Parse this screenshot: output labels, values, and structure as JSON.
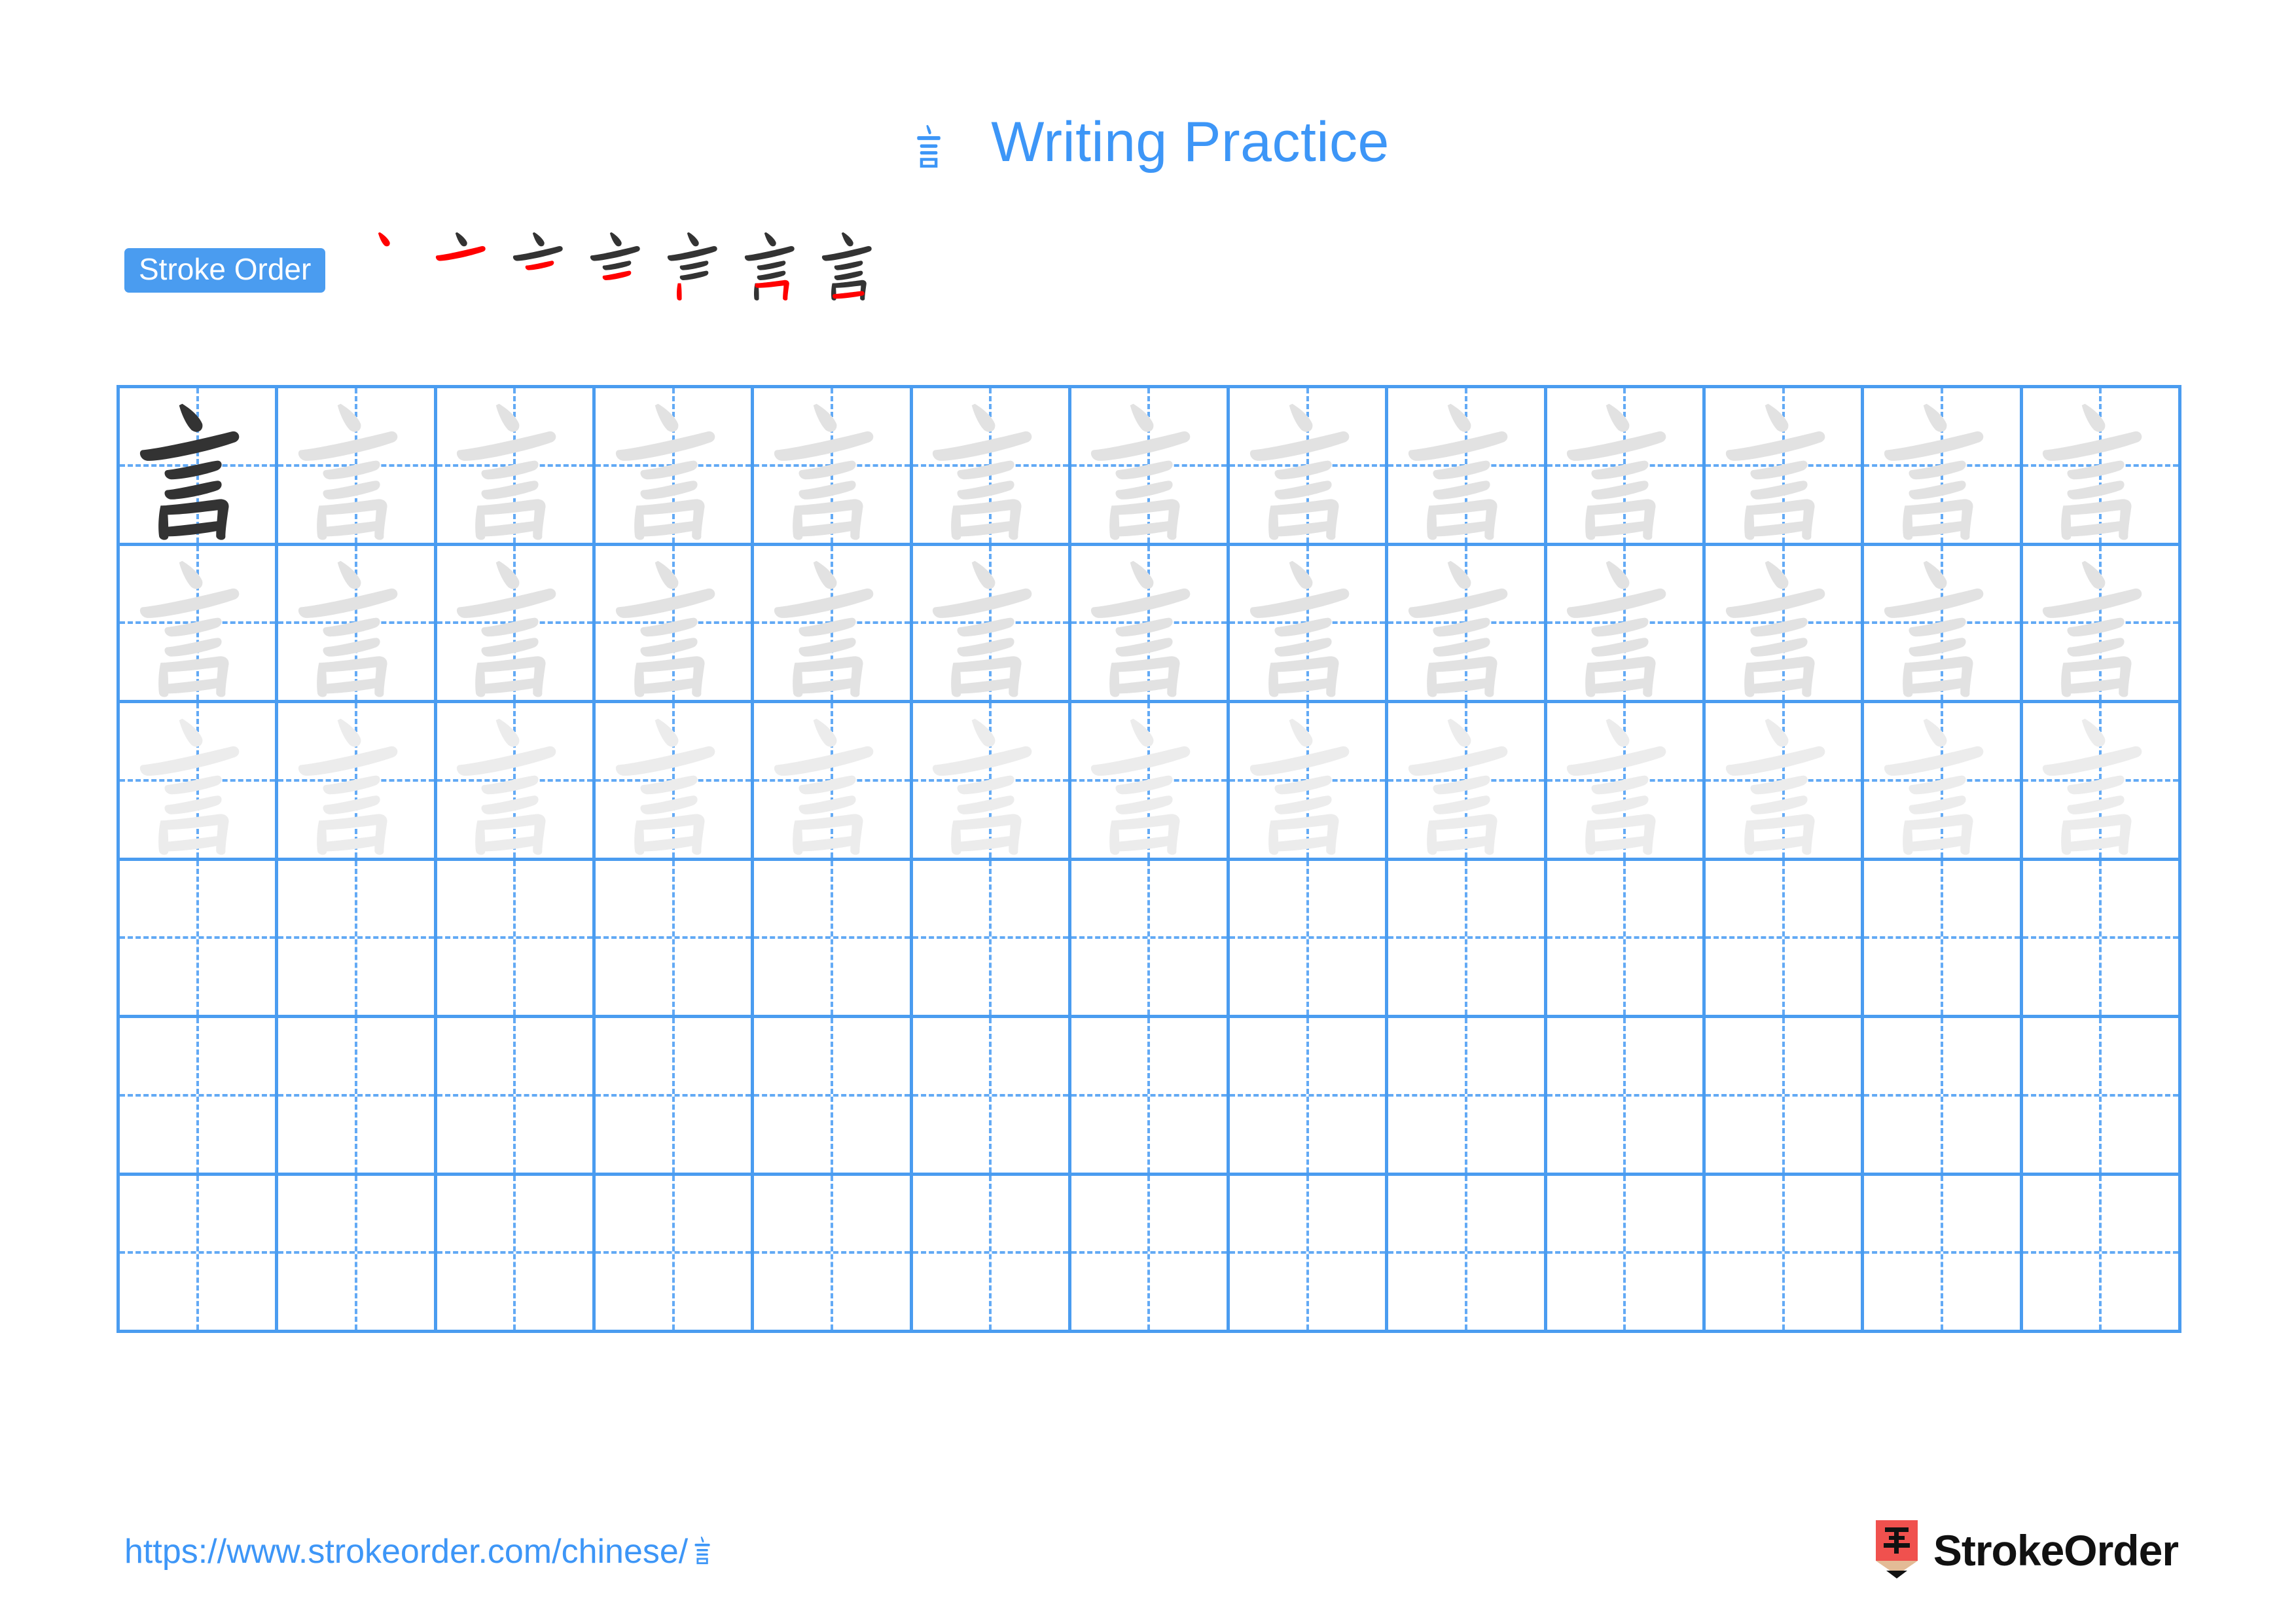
{
  "page": {
    "character": "言",
    "title_text": "Writing Practice",
    "background_color": "#ffffff",
    "accent_blue": "#3d96f7",
    "grid_blue": "#4a9cf0",
    "guide_blue": "#63aaf5",
    "ink_dark": "#333333",
    "ink_new": "#ff0000",
    "ink_trace": "#e2e2e2"
  },
  "stroke_order": {
    "badge_label": "Stroke Order",
    "stroke_count": 7,
    "steps": [
      {
        "index": 1,
        "completed_strokes": 0,
        "new_stroke": 1
      },
      {
        "index": 2,
        "completed_strokes": 1,
        "new_stroke": 2
      },
      {
        "index": 3,
        "completed_strokes": 2,
        "new_stroke": 3
      },
      {
        "index": 4,
        "completed_strokes": 3,
        "new_stroke": 4
      },
      {
        "index": 5,
        "completed_strokes": 4,
        "new_stroke": 5
      },
      {
        "index": 6,
        "completed_strokes": 5,
        "new_stroke": 6
      },
      {
        "index": 7,
        "completed_strokes": 6,
        "new_stroke": 7
      }
    ]
  },
  "grid": {
    "columns": 13,
    "rows": 6,
    "cell_states": [
      [
        "dark",
        "trace",
        "trace",
        "trace",
        "trace",
        "trace",
        "trace",
        "trace",
        "trace",
        "trace",
        "trace",
        "trace",
        "trace"
      ],
      [
        "trace",
        "trace",
        "trace",
        "trace",
        "trace",
        "trace",
        "trace",
        "trace",
        "trace",
        "trace",
        "trace",
        "trace",
        "trace"
      ],
      [
        "trace-light",
        "trace-light",
        "trace-light",
        "trace-light",
        "trace-light",
        "trace-light",
        "trace-light",
        "trace-light",
        "trace-light",
        "trace-light",
        "trace-light",
        "trace-light",
        "trace-light"
      ],
      [
        "empty",
        "empty",
        "empty",
        "empty",
        "empty",
        "empty",
        "empty",
        "empty",
        "empty",
        "empty",
        "empty",
        "empty",
        "empty"
      ],
      [
        "empty",
        "empty",
        "empty",
        "empty",
        "empty",
        "empty",
        "empty",
        "empty",
        "empty",
        "empty",
        "empty",
        "empty",
        "empty"
      ],
      [
        "empty",
        "empty",
        "empty",
        "empty",
        "empty",
        "empty",
        "empty",
        "empty",
        "empty",
        "empty",
        "empty",
        "empty",
        "empty"
      ]
    ]
  },
  "footer": {
    "url_prefix": "https://www.strokeorder.com/chinese/",
    "url_character": "言",
    "logo_character": "字",
    "logo_wordmark": "StrokeOrder",
    "logo_pencil_body": "#f0514e",
    "logo_pencil_wood": "#e3bb96",
    "logo_pencil_tip": "#111111"
  }
}
